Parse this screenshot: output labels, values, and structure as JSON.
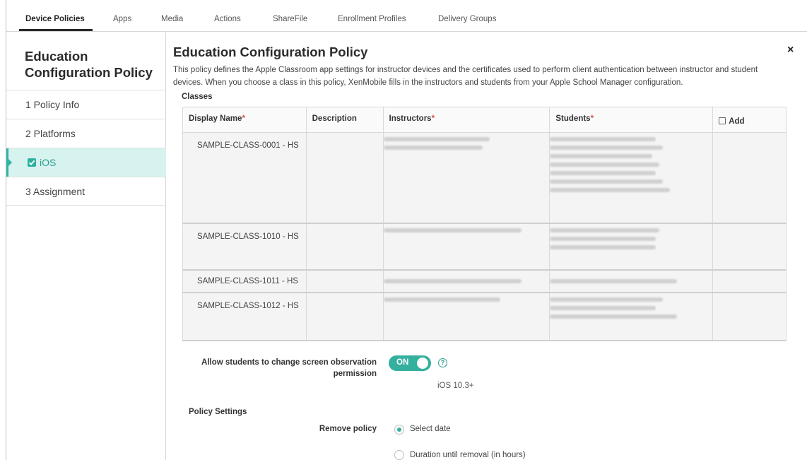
{
  "tabs": [
    {
      "label": "Device Policies",
      "active": true
    },
    {
      "label": "Apps"
    },
    {
      "label": "Media"
    },
    {
      "label": "Actions"
    },
    {
      "label": "ShareFile"
    },
    {
      "label": "Enrollment Profiles"
    },
    {
      "label": "Delivery Groups"
    }
  ],
  "sidebar": {
    "title": "Education Configuration Policy",
    "items": [
      {
        "label": "1 Policy Info"
      },
      {
        "label": "2 Platforms"
      },
      {
        "label": "iOS",
        "checked": true,
        "selected": true
      },
      {
        "label": "3 Assignment"
      }
    ]
  },
  "main": {
    "title": "Education Configuration Policy",
    "close_icon": "×",
    "description": "This policy defines the Apple Classroom app settings for instructor devices and the certificates used to perform client authentication between instructor and student devices. When you choose a class in this policy, XenMobile fills in the instructors and students from your Apple School Manager configuration.",
    "classes_label": "Classes",
    "table": {
      "headers": {
        "display_name": "Display Name",
        "description": "Description",
        "instructors": "Instructors",
        "students": "Students",
        "add": "Add",
        "required_mark": "*"
      },
      "rows": [
        {
          "display_name": "SAMPLE-CLASS-0001 - HS"
        },
        {
          "display_name": "SAMPLE-CLASS-1010 - HS"
        },
        {
          "display_name": "SAMPLE-CLASS-1011 - HS"
        },
        {
          "display_name": "SAMPLE-CLASS-1012 - HS"
        }
      ]
    },
    "screen_observation": {
      "label": "Allow students to change screen observation permission",
      "toggle_text": "ON",
      "enabled": true,
      "help_icon": "?",
      "note": "iOS 10.3+"
    },
    "policy_settings": {
      "label": "Policy Settings",
      "remove_policy_label": "Remove policy",
      "options": [
        {
          "label": "Select date",
          "selected": true
        },
        {
          "label": "Duration until removal (in hours)",
          "selected": false
        }
      ]
    }
  },
  "colors": {
    "accent": "#35b09f",
    "selected_nav_bg": "#d6f3ef",
    "required": "#d9534f"
  }
}
